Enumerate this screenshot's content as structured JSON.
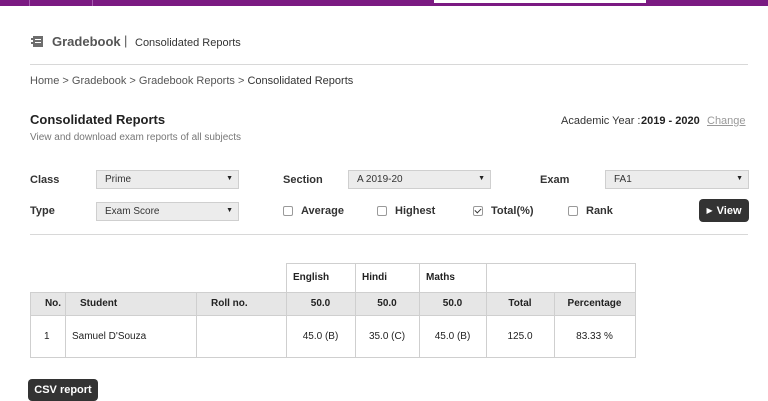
{
  "header": {
    "module_title": "Gradebook",
    "separator": "|",
    "subtitle": "Consolidated Reports"
  },
  "breadcrumb": {
    "home": "Home",
    "gradebook": "Gradebook",
    "gradebook_reports": "Gradebook Reports",
    "current": "Consolidated Reports",
    "sep": ">"
  },
  "page": {
    "title": "Consolidated Reports",
    "description": "View and download exam reports of all subjects"
  },
  "academic_year": {
    "label": "Academic Year :",
    "value": "2019 - 2020",
    "change_link": "Change"
  },
  "filters": {
    "class_label": "Class",
    "class_value": "Prime",
    "section_label": "Section",
    "section_value": "A 2019-20",
    "exam_label": "Exam",
    "exam_value": "FA1",
    "type_label": "Type",
    "type_value": "Exam Score",
    "options": [
      {
        "label": "Average",
        "checked": false
      },
      {
        "label": "Highest",
        "checked": false
      },
      {
        "label": "Total(%)",
        "checked": true
      },
      {
        "label": "Rank",
        "checked": false
      }
    ],
    "view_button": "View"
  },
  "table": {
    "subjects": [
      "English",
      "Hindi",
      "Maths"
    ],
    "columns": {
      "no": "No.",
      "student": "Student",
      "roll": "Roll no.",
      "total": "Total",
      "percentage": "Percentage"
    },
    "max_marks": [
      "50.0",
      "50.0",
      "50.0"
    ],
    "rows": [
      {
        "no": "1",
        "student": "Samuel D'Souza",
        "roll": "",
        "scores": [
          "45.0 (B)",
          "35.0 (C)",
          "45.0 (B)"
        ],
        "total": "125.0",
        "percentage": "83.33 %"
      }
    ]
  },
  "csv_button": "CSV report",
  "colors": {
    "brand": "#7b1a82",
    "button_dark": "#333333",
    "header_row": "#e6e6e6"
  }
}
